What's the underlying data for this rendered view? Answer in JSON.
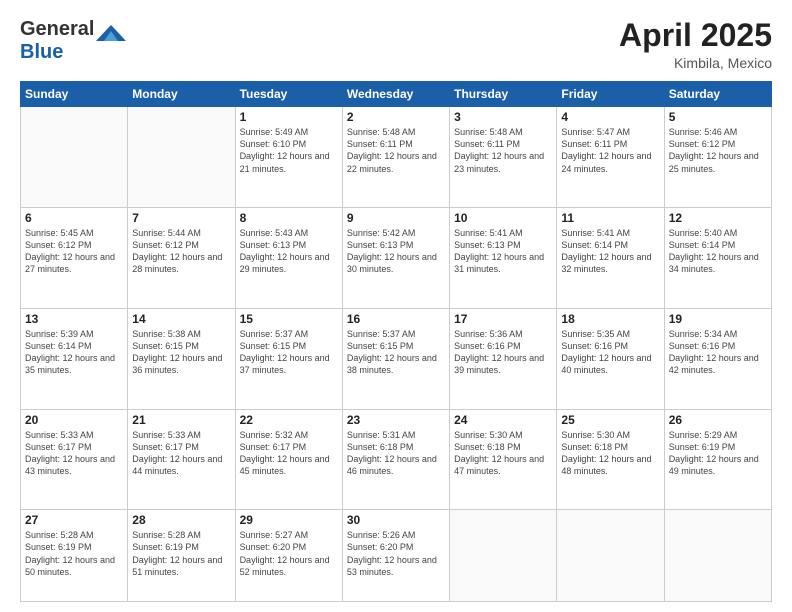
{
  "header": {
    "logo": {
      "line1": "General",
      "line2": "Blue"
    },
    "title": "April 2025",
    "location": "Kimbila, Mexico"
  },
  "weekdays": [
    "Sunday",
    "Monday",
    "Tuesday",
    "Wednesday",
    "Thursday",
    "Friday",
    "Saturday"
  ],
  "weeks": [
    [
      {
        "day": null
      },
      {
        "day": null
      },
      {
        "day": "1",
        "sunrise": "Sunrise: 5:49 AM",
        "sunset": "Sunset: 6:10 PM",
        "daylight": "Daylight: 12 hours and 21 minutes."
      },
      {
        "day": "2",
        "sunrise": "Sunrise: 5:48 AM",
        "sunset": "Sunset: 6:11 PM",
        "daylight": "Daylight: 12 hours and 22 minutes."
      },
      {
        "day": "3",
        "sunrise": "Sunrise: 5:48 AM",
        "sunset": "Sunset: 6:11 PM",
        "daylight": "Daylight: 12 hours and 23 minutes."
      },
      {
        "day": "4",
        "sunrise": "Sunrise: 5:47 AM",
        "sunset": "Sunset: 6:11 PM",
        "daylight": "Daylight: 12 hours and 24 minutes."
      },
      {
        "day": "5",
        "sunrise": "Sunrise: 5:46 AM",
        "sunset": "Sunset: 6:12 PM",
        "daylight": "Daylight: 12 hours and 25 minutes."
      }
    ],
    [
      {
        "day": "6",
        "sunrise": "Sunrise: 5:45 AM",
        "sunset": "Sunset: 6:12 PM",
        "daylight": "Daylight: 12 hours and 27 minutes."
      },
      {
        "day": "7",
        "sunrise": "Sunrise: 5:44 AM",
        "sunset": "Sunset: 6:12 PM",
        "daylight": "Daylight: 12 hours and 28 minutes."
      },
      {
        "day": "8",
        "sunrise": "Sunrise: 5:43 AM",
        "sunset": "Sunset: 6:13 PM",
        "daylight": "Daylight: 12 hours and 29 minutes."
      },
      {
        "day": "9",
        "sunrise": "Sunrise: 5:42 AM",
        "sunset": "Sunset: 6:13 PM",
        "daylight": "Daylight: 12 hours and 30 minutes."
      },
      {
        "day": "10",
        "sunrise": "Sunrise: 5:41 AM",
        "sunset": "Sunset: 6:13 PM",
        "daylight": "Daylight: 12 hours and 31 minutes."
      },
      {
        "day": "11",
        "sunrise": "Sunrise: 5:41 AM",
        "sunset": "Sunset: 6:14 PM",
        "daylight": "Daylight: 12 hours and 32 minutes."
      },
      {
        "day": "12",
        "sunrise": "Sunrise: 5:40 AM",
        "sunset": "Sunset: 6:14 PM",
        "daylight": "Daylight: 12 hours and 34 minutes."
      }
    ],
    [
      {
        "day": "13",
        "sunrise": "Sunrise: 5:39 AM",
        "sunset": "Sunset: 6:14 PM",
        "daylight": "Daylight: 12 hours and 35 minutes."
      },
      {
        "day": "14",
        "sunrise": "Sunrise: 5:38 AM",
        "sunset": "Sunset: 6:15 PM",
        "daylight": "Daylight: 12 hours and 36 minutes."
      },
      {
        "day": "15",
        "sunrise": "Sunrise: 5:37 AM",
        "sunset": "Sunset: 6:15 PM",
        "daylight": "Daylight: 12 hours and 37 minutes."
      },
      {
        "day": "16",
        "sunrise": "Sunrise: 5:37 AM",
        "sunset": "Sunset: 6:15 PM",
        "daylight": "Daylight: 12 hours and 38 minutes."
      },
      {
        "day": "17",
        "sunrise": "Sunrise: 5:36 AM",
        "sunset": "Sunset: 6:16 PM",
        "daylight": "Daylight: 12 hours and 39 minutes."
      },
      {
        "day": "18",
        "sunrise": "Sunrise: 5:35 AM",
        "sunset": "Sunset: 6:16 PM",
        "daylight": "Daylight: 12 hours and 40 minutes."
      },
      {
        "day": "19",
        "sunrise": "Sunrise: 5:34 AM",
        "sunset": "Sunset: 6:16 PM",
        "daylight": "Daylight: 12 hours and 42 minutes."
      }
    ],
    [
      {
        "day": "20",
        "sunrise": "Sunrise: 5:33 AM",
        "sunset": "Sunset: 6:17 PM",
        "daylight": "Daylight: 12 hours and 43 minutes."
      },
      {
        "day": "21",
        "sunrise": "Sunrise: 5:33 AM",
        "sunset": "Sunset: 6:17 PM",
        "daylight": "Daylight: 12 hours and 44 minutes."
      },
      {
        "day": "22",
        "sunrise": "Sunrise: 5:32 AM",
        "sunset": "Sunset: 6:17 PM",
        "daylight": "Daylight: 12 hours and 45 minutes."
      },
      {
        "day": "23",
        "sunrise": "Sunrise: 5:31 AM",
        "sunset": "Sunset: 6:18 PM",
        "daylight": "Daylight: 12 hours and 46 minutes."
      },
      {
        "day": "24",
        "sunrise": "Sunrise: 5:30 AM",
        "sunset": "Sunset: 6:18 PM",
        "daylight": "Daylight: 12 hours and 47 minutes."
      },
      {
        "day": "25",
        "sunrise": "Sunrise: 5:30 AM",
        "sunset": "Sunset: 6:18 PM",
        "daylight": "Daylight: 12 hours and 48 minutes."
      },
      {
        "day": "26",
        "sunrise": "Sunrise: 5:29 AM",
        "sunset": "Sunset: 6:19 PM",
        "daylight": "Daylight: 12 hours and 49 minutes."
      }
    ],
    [
      {
        "day": "27",
        "sunrise": "Sunrise: 5:28 AM",
        "sunset": "Sunset: 6:19 PM",
        "daylight": "Daylight: 12 hours and 50 minutes."
      },
      {
        "day": "28",
        "sunrise": "Sunrise: 5:28 AM",
        "sunset": "Sunset: 6:19 PM",
        "daylight": "Daylight: 12 hours and 51 minutes."
      },
      {
        "day": "29",
        "sunrise": "Sunrise: 5:27 AM",
        "sunset": "Sunset: 6:20 PM",
        "daylight": "Daylight: 12 hours and 52 minutes."
      },
      {
        "day": "30",
        "sunrise": "Sunrise: 5:26 AM",
        "sunset": "Sunset: 6:20 PM",
        "daylight": "Daylight: 12 hours and 53 minutes."
      },
      {
        "day": null
      },
      {
        "day": null
      },
      {
        "day": null
      }
    ]
  ]
}
